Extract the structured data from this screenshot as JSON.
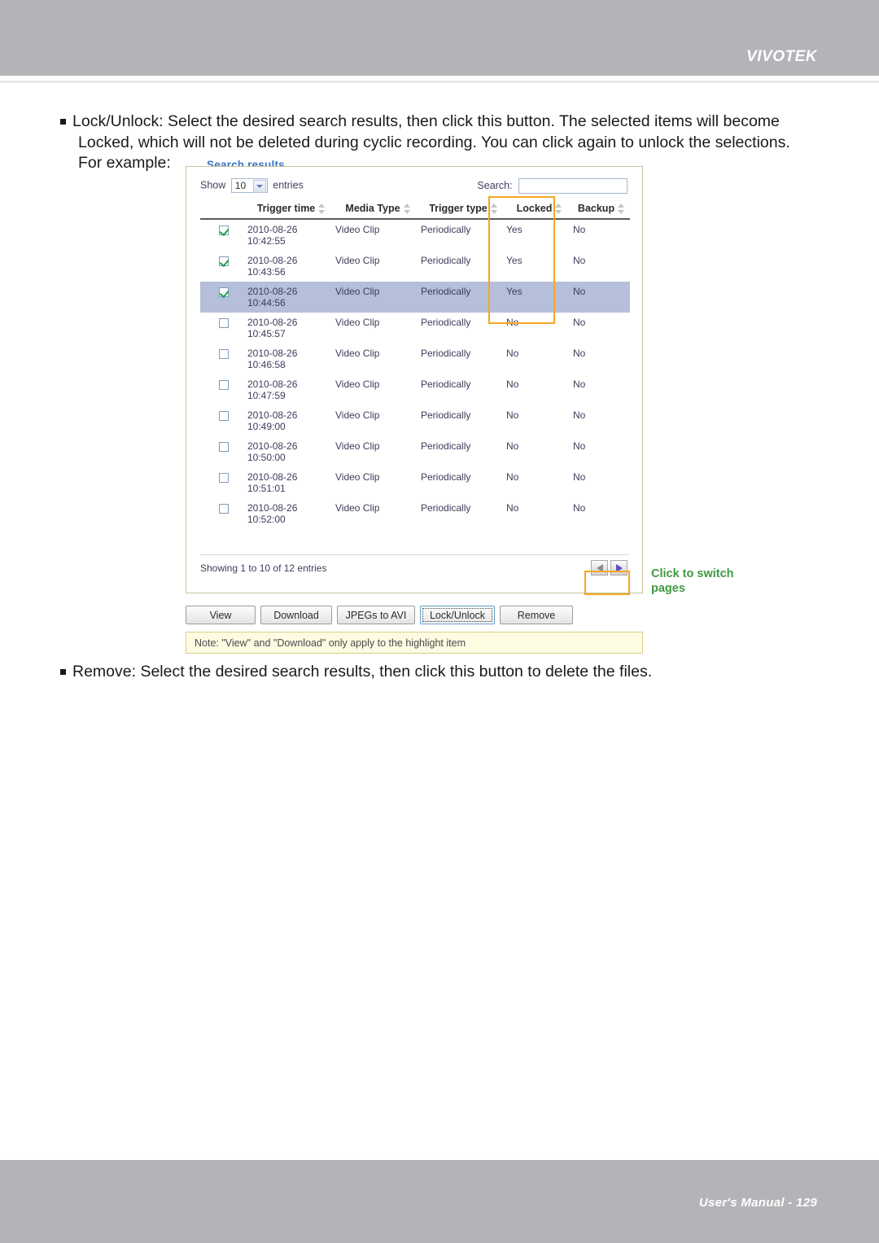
{
  "header": {
    "brand": "VIVOTEK"
  },
  "footer": {
    "text": "User's Manual - 129"
  },
  "body_copy": {
    "lock_bullet_line1": "Lock/Unlock: Select the desired search results, then click this button. The selected items will become",
    "lock_bullet_line2": "Locked, which will not be deleted during cyclic recording. You can click again to unlock the selections.",
    "lock_bullet_line3": "For example:",
    "remove_bullet": "Remove: Select the desired search results, then click this button to delete the files."
  },
  "panel": {
    "legend": "Search results",
    "show_label_prefix": "Show",
    "show_label_suffix": "entries",
    "length_value": "10",
    "search_label": "Search:",
    "search_value": "",
    "search_placeholder": ""
  },
  "table": {
    "columns": [
      "",
      "Trigger time",
      "Media Type",
      "Trigger type",
      "Locked",
      "Backup"
    ],
    "rows": [
      {
        "checked": true,
        "highlight": false,
        "date": "2010-08-26",
        "time": "10:42:55",
        "media": "Video Clip",
        "trigger": "Periodically",
        "locked": "Yes",
        "backup": "No"
      },
      {
        "checked": true,
        "highlight": false,
        "date": "2010-08-26",
        "time": "10:43:56",
        "media": "Video Clip",
        "trigger": "Periodically",
        "locked": "Yes",
        "backup": "No"
      },
      {
        "checked": true,
        "highlight": true,
        "date": "2010-08-26",
        "time": "10:44:56",
        "media": "Video Clip",
        "trigger": "Periodically",
        "locked": "Yes",
        "backup": "No"
      },
      {
        "checked": false,
        "highlight": false,
        "date": "2010-08-26",
        "time": "10:45:57",
        "media": "Video Clip",
        "trigger": "Periodically",
        "locked": "No",
        "backup": "No"
      },
      {
        "checked": false,
        "highlight": false,
        "date": "2010-08-26",
        "time": "10:46:58",
        "media": "Video Clip",
        "trigger": "Periodically",
        "locked": "No",
        "backup": "No"
      },
      {
        "checked": false,
        "highlight": false,
        "date": "2010-08-26",
        "time": "10:47:59",
        "media": "Video Clip",
        "trigger": "Periodically",
        "locked": "No",
        "backup": "No"
      },
      {
        "checked": false,
        "highlight": false,
        "date": "2010-08-26",
        "time": "10:49:00",
        "media": "Video Clip",
        "trigger": "Periodically",
        "locked": "No",
        "backup": "No"
      },
      {
        "checked": false,
        "highlight": false,
        "date": "2010-08-26",
        "time": "10:50:00",
        "media": "Video Clip",
        "trigger": "Periodically",
        "locked": "No",
        "backup": "No"
      },
      {
        "checked": false,
        "highlight": false,
        "date": "2010-08-26",
        "time": "10:51:01",
        "media": "Video Clip",
        "trigger": "Periodically",
        "locked": "No",
        "backup": "No"
      },
      {
        "checked": false,
        "highlight": false,
        "date": "2010-08-26",
        "time": "10:52:00",
        "media": "Video Clip",
        "trigger": "Periodically",
        "locked": "No",
        "backup": "No"
      }
    ],
    "showing_info": "Showing 1 to 10 of 12 entries",
    "prev_icon": "triangle-left-icon",
    "next_icon": "triangle-right-icon"
  },
  "annotations": {
    "switch_pages_line1": "Click to switch",
    "switch_pages_line2": "pages",
    "callout_color": "#3f9a42",
    "highlight_color": "#f5a623"
  },
  "actions": {
    "view": "View",
    "download": "Download",
    "jpegs_to_avi": "JPEGs to AVI",
    "lock_unlock": "Lock/Unlock",
    "remove": "Remove"
  },
  "note": {
    "text": "Note: \"View\" and \"Download\" only apply to the highlight item"
  }
}
